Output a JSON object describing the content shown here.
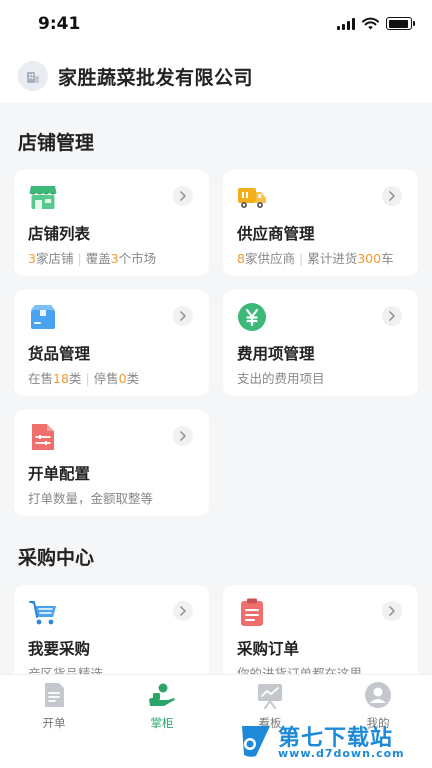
{
  "status_bar": {
    "time": "9:41",
    "battery_level": 0.95
  },
  "header": {
    "company_name": "家胜蔬菜批发有限公司",
    "logo_icon": "building-icon"
  },
  "store_section": {
    "title": "店铺管理",
    "cards": [
      {
        "title": "店铺列表",
        "icon": "storefront-icon",
        "icon_color": "#3cb878",
        "sub": [
          {
            "hl": "3"
          },
          {
            "t": "家店铺"
          },
          {
            "sep": "|"
          },
          {
            "t": "覆盖"
          },
          {
            "hl": "3"
          },
          {
            "t": "个市场"
          }
        ]
      },
      {
        "title": "供应商管理",
        "icon": "delivery-truck-icon",
        "icon_color": "#f3ae1b",
        "sub": [
          {
            "hl": "8"
          },
          {
            "t": "家供应商"
          },
          {
            "sep": "|"
          },
          {
            "t": "累计进货"
          },
          {
            "hl": "300"
          },
          {
            "t": "车"
          }
        ]
      },
      {
        "title": "货品管理",
        "icon": "package-box-icon",
        "icon_color": "#4aa3f0",
        "sub": [
          {
            "t": "在售"
          },
          {
            "hl": "18"
          },
          {
            "t": "类"
          },
          {
            "sep": "|"
          },
          {
            "t": "停售"
          },
          {
            "hl": "0"
          },
          {
            "t": "类"
          }
        ]
      },
      {
        "title": "费用项管理",
        "icon": "yen-coin-icon",
        "icon_color": "#3cb878",
        "sub": [
          {
            "t": "支出的费用项目"
          }
        ]
      },
      {
        "title": "开单配置",
        "icon": "settings-document-icon",
        "icon_color": "#ef6f6c",
        "sub": [
          {
            "t": "打单数量，金额取整等"
          }
        ]
      }
    ]
  },
  "purchase_section": {
    "title": "采购中心",
    "cards": [
      {
        "title": "我要采购",
        "icon": "shopping-cart-icon",
        "icon_color": "#4aa3f0",
        "sub": [
          {
            "t": "产区货品精选"
          }
        ]
      },
      {
        "title": "采购订单",
        "icon": "clipboard-order-icon",
        "icon_color": "#ef6f6c",
        "sub": [
          {
            "t": "你的进货订单都在这里"
          }
        ]
      }
    ]
  },
  "tabbar": {
    "tabs": [
      {
        "label": "开单",
        "icon": "receipt-icon",
        "active": false
      },
      {
        "label": "掌柜",
        "icon": "shopkeeper-icon",
        "active": true
      },
      {
        "label": "看板",
        "icon": "chart-board-icon",
        "active": false
      },
      {
        "label": "我的",
        "icon": "user-profile-icon",
        "active": false
      }
    ],
    "active_color": "#2ca56b",
    "inactive_color": "#c4c8cc"
  },
  "watermark": {
    "title": "第七下载站",
    "url": "www.d7down.com",
    "color": "#1d8ad9"
  }
}
